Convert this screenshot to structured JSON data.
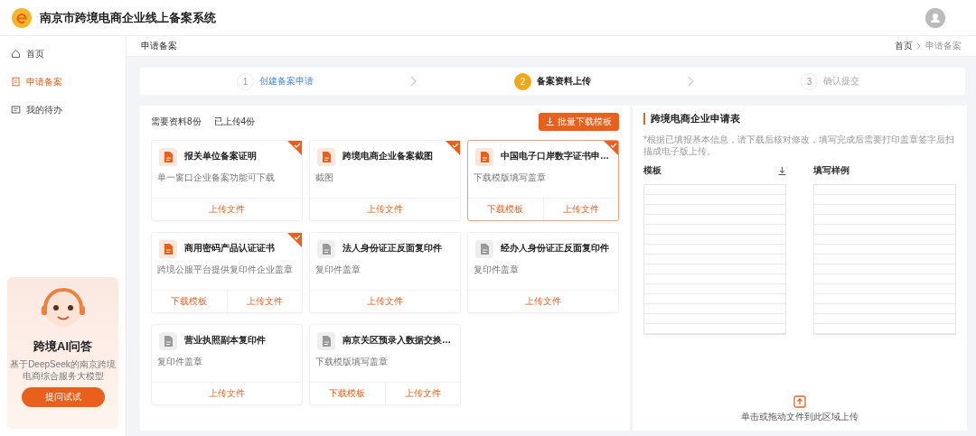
{
  "header": {
    "title": "南京市跨境电商企业线上备案系统"
  },
  "sidebar": {
    "items": [
      {
        "label": "首页",
        "selected": false
      },
      {
        "label": "申请备案",
        "selected": true
      },
      {
        "label": "我的待办",
        "selected": false
      }
    ],
    "ai_card": {
      "title": "跨境AI问答",
      "description": "基于DeepSeek的南京跨境电商综合服务大模型",
      "button": "提问试试"
    }
  },
  "page_title": "申请备案",
  "breadcrumb": [
    "首页",
    "申请备案"
  ],
  "steps": [
    {
      "number": "1",
      "label": "创建备案申请",
      "completed": true,
      "selected": false
    },
    {
      "number": "2",
      "label": "备案资料上传",
      "completed": false,
      "selected": true
    },
    {
      "number": "3",
      "label": "确认提交",
      "completed": false,
      "selected": false
    }
  ],
  "materials": {
    "required": "需要资料8份",
    "uploaded": "已上传4份",
    "batch_button": "批量下载模板",
    "cards": [
      {
        "title": "报关单位备案证明",
        "description": "单一窗口企业备案功能可下载",
        "actions": [
          "上传文件"
        ],
        "uploaded": true,
        "selected": false
      },
      {
        "title": "跨境电商企业备案截图",
        "description": "截图",
        "actions": [
          "上传文件"
        ],
        "uploaded": true,
        "selected": false
      },
      {
        "title": "中国电子口岸数字证书申…",
        "description": "下载模版填写盖章",
        "actions": [
          "下载模板",
          "上传文件"
        ],
        "uploaded": true,
        "selected": true
      },
      {
        "title": "商用密码产品认证证书",
        "description": "跨境公服平台提供复印件企业盖章",
        "actions": [
          "下载模板",
          "上传文件"
        ],
        "uploaded": true,
        "selected": false
      },
      {
        "title": "法人身份证正反面复印件",
        "description": "复印件盖章",
        "actions": [
          "上传文件"
        ],
        "uploaded": false,
        "selected": false
      },
      {
        "title": "经办人身份证正反面复印件",
        "description": "复印件盖章",
        "actions": [
          "上传文件"
        ],
        "uploaded": false,
        "selected": false
      },
      {
        "title": "营业执照副本复印件",
        "description": "复印件盖章",
        "actions": [
          "上传文件"
        ],
        "uploaded": false,
        "selected": false
      },
      {
        "title": "南京关区预录入数据交换…",
        "description": "下载模版填写盖章",
        "actions": [
          "下载模板",
          "上传文件"
        ],
        "uploaded": false,
        "selected": false
      }
    ]
  },
  "detail": {
    "title": "跨境电商企业申请表",
    "hint": "*根据已填报基本信息，请下载后核对修改，填写完成后需要打印盖章签字后扫描成电子版上传。",
    "template_label": "模板",
    "sample_label": "填写样例",
    "upload_hint": "单击或拖动文件到此区域上传"
  }
}
